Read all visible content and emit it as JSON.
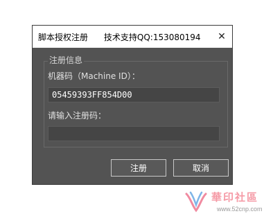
{
  "window": {
    "title": "脚本授权注册      技术支持QQ:153080194",
    "close_symbol": "✕"
  },
  "group": {
    "title": "注册信息",
    "machine_id_label": "机器码（Machine ID）：",
    "machine_id_value": "05459393FF854D00",
    "reg_code_label": "请输入注册码：",
    "reg_code_value": ""
  },
  "buttons": {
    "register": "注册",
    "cancel": "取消"
  },
  "watermark": {
    "name": "華印社區",
    "url": "www.52cnp.com"
  },
  "colors": {
    "dialog_bg": "#535353",
    "titlebar_bg": "#ffffff",
    "watermark": "#f59aa6"
  }
}
